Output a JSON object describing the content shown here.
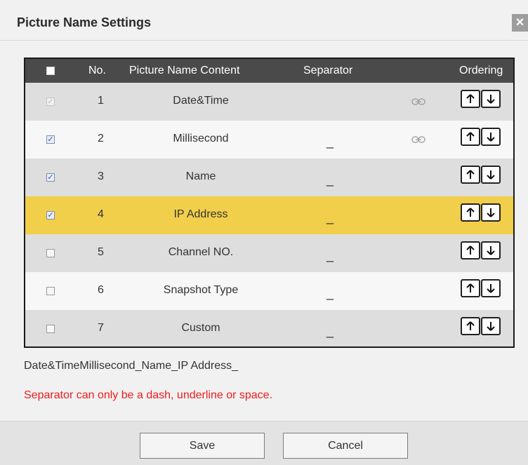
{
  "dialog": {
    "title": "Picture Name Settings",
    "close_label": "×"
  },
  "table": {
    "headers": {
      "select_all_checked": false,
      "no": "No.",
      "content": "Picture Name Content",
      "separator": "Separator",
      "ordering": "Ordering"
    },
    "rows": [
      {
        "no": "1",
        "content": "Date&Time",
        "separator": "",
        "checked": true,
        "disabled": true,
        "linked": true,
        "selected": false
      },
      {
        "no": "2",
        "content": "Millisecond",
        "separator": "_",
        "checked": true,
        "disabled": false,
        "linked": true,
        "selected": false
      },
      {
        "no": "3",
        "content": "Name",
        "separator": "_",
        "checked": true,
        "disabled": false,
        "linked": false,
        "selected": false
      },
      {
        "no": "4",
        "content": "IP Address",
        "separator": "_",
        "checked": true,
        "disabled": false,
        "linked": false,
        "selected": true
      },
      {
        "no": "5",
        "content": "Channel NO.",
        "separator": "_",
        "checked": false,
        "disabled": false,
        "linked": false,
        "selected": false
      },
      {
        "no": "6",
        "content": "Snapshot Type",
        "separator": "_",
        "checked": false,
        "disabled": false,
        "linked": false,
        "selected": false
      },
      {
        "no": "7",
        "content": "Custom",
        "separator": "_",
        "checked": false,
        "disabled": false,
        "linked": false,
        "selected": false
      }
    ]
  },
  "preview_text": "Date&TimeMillisecond_Name_IP Address_",
  "warning_text": "Separator can only be a dash, underline or space.",
  "footer": {
    "save_label": "Save",
    "cancel_label": "Cancel"
  },
  "colors": {
    "header_bg": "#4a4a4a",
    "selected_row": "#f2cf4b",
    "warning": "#ee1c1c"
  },
  "icons": {
    "link": "link-icon",
    "up": "arrow-up-icon",
    "down": "arrow-down-icon",
    "close": "close-icon"
  }
}
